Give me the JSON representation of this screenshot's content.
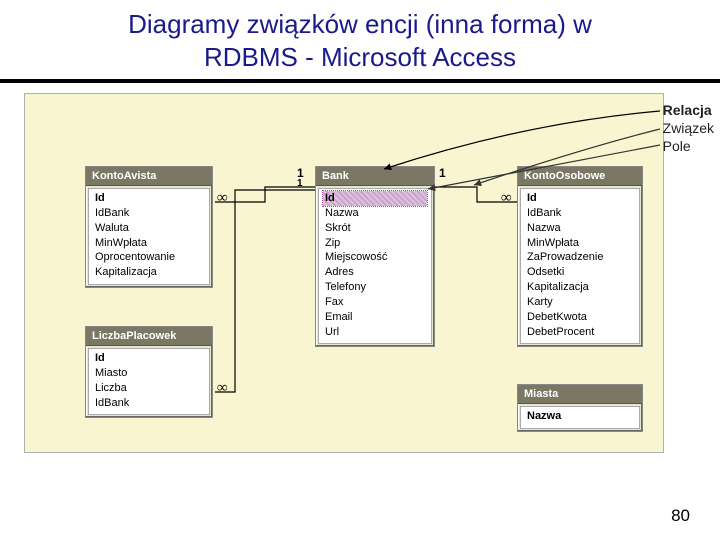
{
  "title_line1": "Diagramy związków encji (inna forma) w",
  "title_line2": "RDBMS - Microsoft Access",
  "legend": {
    "relacja": "Relacja",
    "zwiazek": "Związek",
    "pole": "Pole"
  },
  "entities": {
    "kontoAvista": {
      "name": "KontoAvista",
      "fields": [
        "Id",
        "IdBank",
        "Waluta",
        "MinWpłata",
        "Oprocentowanie",
        "Kapitalizacja"
      ]
    },
    "bank": {
      "name": "Bank",
      "fields": [
        "Id",
        "Nazwa",
        "Skrót",
        "Zip",
        "Miejscowość",
        "Adres",
        "Telefony",
        "Fax",
        "Email",
        "Url"
      ]
    },
    "kontoOsobowe": {
      "name": "KontoOsobowe",
      "fields": [
        "Id",
        "IdBank",
        "Nazwa",
        "MinWpłata",
        "ZaProwadzenie",
        "Odsetki",
        "Kapitalizacja",
        "Karty",
        "DebetKwota",
        "DebetProcent"
      ]
    },
    "liczbaPlacowek": {
      "name": "LiczbaPlacowek",
      "fields": [
        "Id",
        "Miasto",
        "Liczba",
        "IdBank"
      ]
    },
    "miasta": {
      "name": "Miasta",
      "fields": [
        "Nazwa"
      ]
    }
  },
  "cardinality": {
    "one": "1",
    "many": "∞"
  },
  "page_number": "80"
}
